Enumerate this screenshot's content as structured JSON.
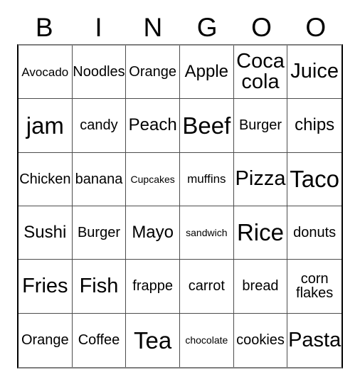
{
  "card": {
    "title_letters": [
      "B",
      "I",
      "N",
      "G",
      "O",
      "O"
    ],
    "columns": 6,
    "rows": 6,
    "grid_border_color": "#000000",
    "cell_line_color": "#4d4d4d",
    "background_color": "#ffffff",
    "text_color": "#000000",
    "cells": [
      [
        {
          "label": "Avocado",
          "size": "s"
        },
        {
          "label": "Noodles",
          "size": "m"
        },
        {
          "label": "Orange",
          "size": "m"
        },
        {
          "label": "Apple",
          "size": "l"
        },
        {
          "label": "Coca\ncola",
          "size": "xl"
        },
        {
          "label": "Juice",
          "size": "xl"
        }
      ],
      [
        {
          "label": "jam",
          "size": "xxl"
        },
        {
          "label": "candy",
          "size": "m"
        },
        {
          "label": "Peach",
          "size": "l"
        },
        {
          "label": "Beef",
          "size": "xxl"
        },
        {
          "label": "Burger",
          "size": "m"
        },
        {
          "label": "chips",
          "size": "l"
        }
      ],
      [
        {
          "label": "Chicken",
          "size": "m"
        },
        {
          "label": "banana",
          "size": "m"
        },
        {
          "label": "Cupcakes",
          "size": "xs"
        },
        {
          "label": "muffins",
          "size": "s"
        },
        {
          "label": "Pizza",
          "size": "xl"
        },
        {
          "label": "Taco",
          "size": "xxl"
        }
      ],
      [
        {
          "label": "Sushi",
          "size": "l"
        },
        {
          "label": "Burger",
          "size": "m"
        },
        {
          "label": "Mayo",
          "size": "l"
        },
        {
          "label": "sandwich",
          "size": "xs"
        },
        {
          "label": "Rice",
          "size": "xxl"
        },
        {
          "label": "donuts",
          "size": "m"
        }
      ],
      [
        {
          "label": "Fries",
          "size": "xl"
        },
        {
          "label": "Fish",
          "size": "xl"
        },
        {
          "label": "frappe",
          "size": "m"
        },
        {
          "label": "carrot",
          "size": "m"
        },
        {
          "label": "bread",
          "size": "m"
        },
        {
          "label": "corn\nflakes",
          "size": "m"
        }
      ],
      [
        {
          "label": "Orange",
          "size": "m"
        },
        {
          "label": "Coffee",
          "size": "m"
        },
        {
          "label": "Tea",
          "size": "xxl"
        },
        {
          "label": "chocolate",
          "size": "xs"
        },
        {
          "label": "cookies",
          "size": "m"
        },
        {
          "label": "Pasta",
          "size": "xl"
        }
      ]
    ]
  }
}
